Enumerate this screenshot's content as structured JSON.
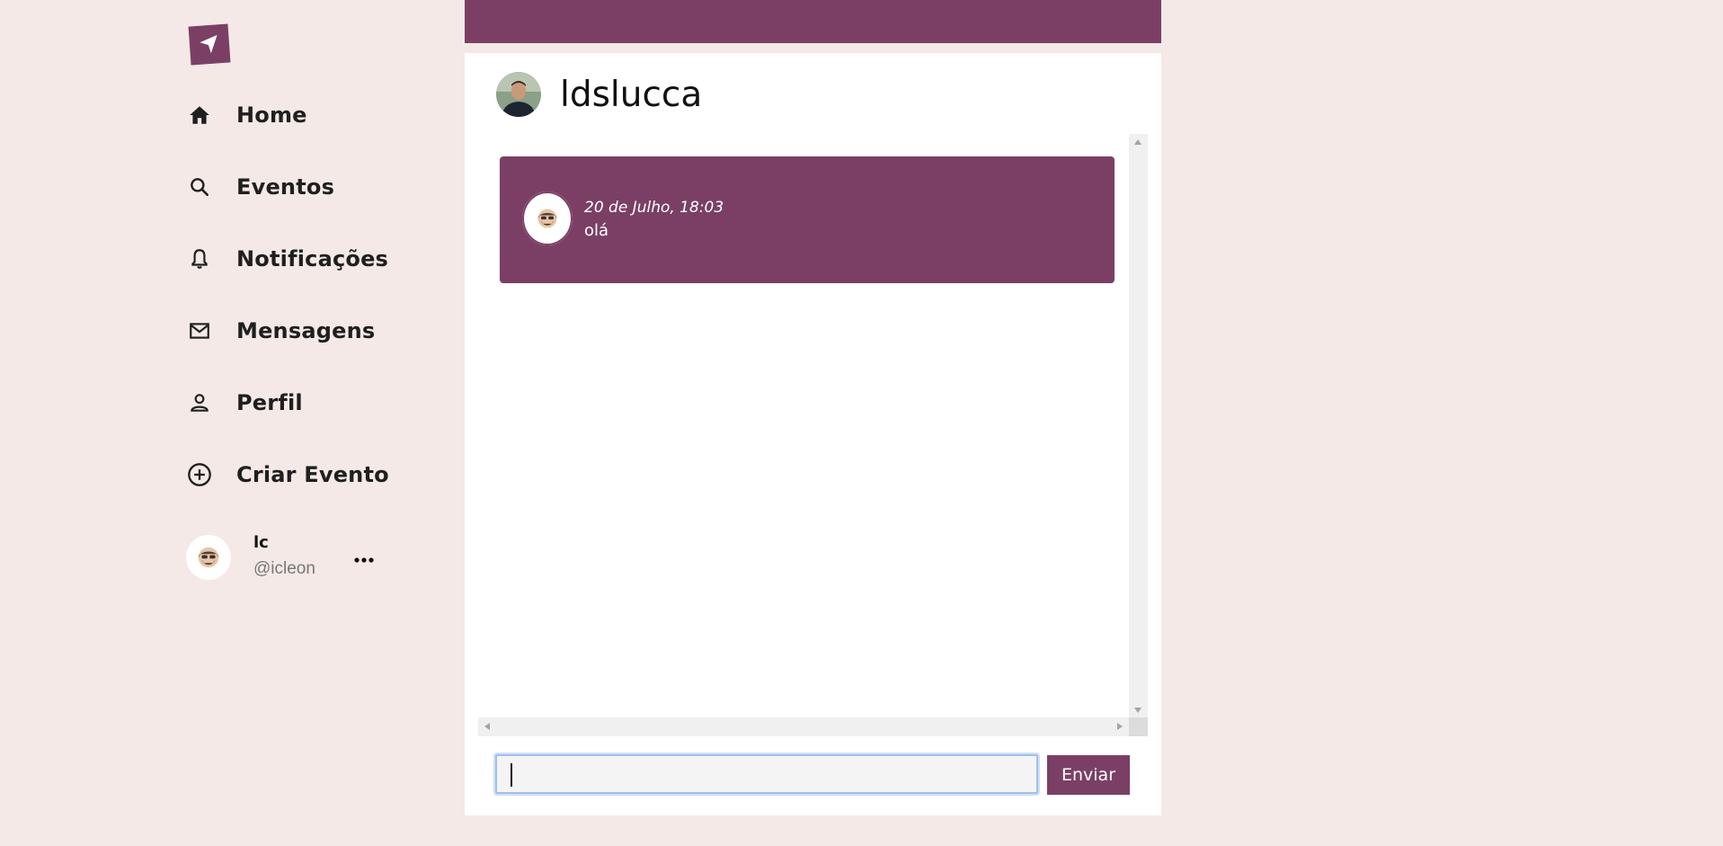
{
  "sidebar": {
    "logo_icon": "paper-plane-icon",
    "items": [
      {
        "label": "Home",
        "icon": "home-icon"
      },
      {
        "label": "Eventos",
        "icon": "search-icon"
      },
      {
        "label": "Notificações",
        "icon": "bell-icon"
      },
      {
        "label": "Mensagens",
        "icon": "mail-icon"
      },
      {
        "label": "Perfil",
        "icon": "person-icon"
      },
      {
        "label": "Criar Evento",
        "icon": "plus-circle-icon"
      }
    ],
    "user": {
      "name": "lc",
      "handle": "@icleon",
      "more_icon": "more-horizontal-icon"
    }
  },
  "chat": {
    "contact_name": "ldslucca",
    "messages": [
      {
        "time": "20 de Julho, 18:03",
        "text": "olá"
      }
    ],
    "input": {
      "value": "",
      "placeholder": ""
    },
    "send_label": "Enviar"
  },
  "colors": {
    "accent": "#7b3f65",
    "background": "#f4e9e7",
    "panel": "#ffffff"
  }
}
